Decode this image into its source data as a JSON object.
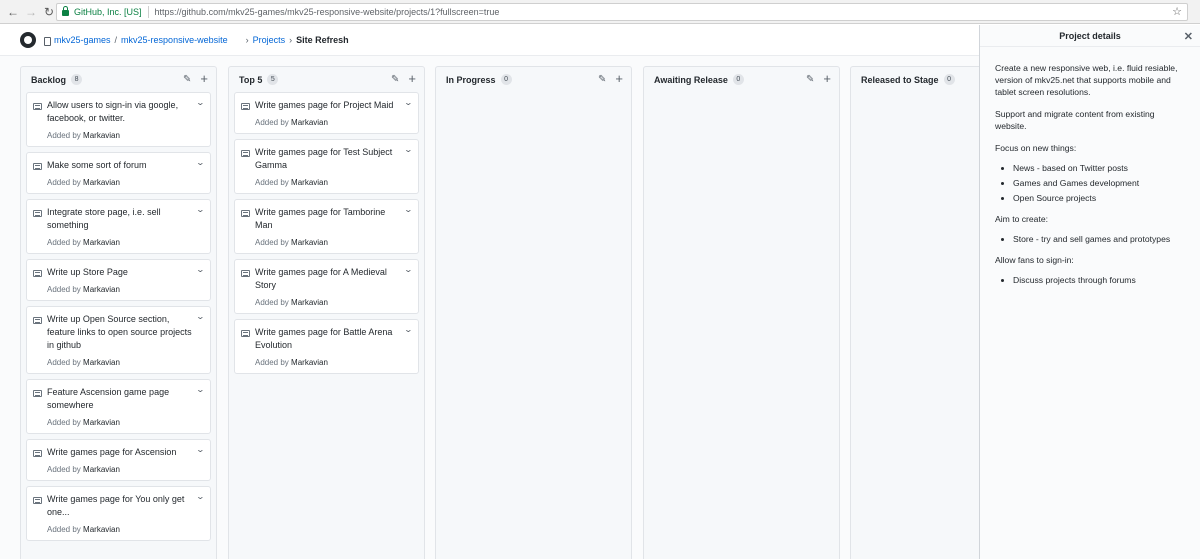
{
  "browser": {
    "secure_label": "GitHub, Inc. [US]",
    "url": "https://github.com/mkv25-games/mkv25-responsive-website/projects/1?fullscreen=true",
    "back_icon": "arrow-left-icon",
    "forward_icon": "arrow-right-icon",
    "reload_icon": "reload-icon",
    "star_icon": "star-icon"
  },
  "header": {
    "owner": "mkv25-games",
    "slash": "/",
    "repo": "mkv25-responsive-website",
    "crumb_sep": "›",
    "projects": "Projects",
    "project_name": "Site Refresh"
  },
  "columns": [
    {
      "name": "Backlog",
      "count": "8",
      "cards": [
        {
          "title": "Allow users to sign-in via google, facebook, or twitter.",
          "added_by": "Added by",
          "author": "Markavian"
        },
        {
          "title": "Make some sort of forum",
          "added_by": "Added by",
          "author": "Markavian"
        },
        {
          "title": "Integrate store page, i.e. sell something",
          "added_by": "Added by",
          "author": "Markavian"
        },
        {
          "title": "Write up Store Page",
          "added_by": "Added by",
          "author": "Markavian"
        },
        {
          "title": "Write up Open Source section, feature links to open source projects in github",
          "added_by": "Added by",
          "author": "Markavian"
        },
        {
          "title": "Feature Ascension game page somewhere",
          "added_by": "Added by",
          "author": "Markavian"
        },
        {
          "title": "Write games page for Ascension",
          "added_by": "Added by",
          "author": "Markavian"
        },
        {
          "title": "Write games page for You only get one...",
          "added_by": "Added by",
          "author": "Markavian"
        }
      ]
    },
    {
      "name": "Top 5",
      "count": "5",
      "cards": [
        {
          "title": "Write games page for Project Maid",
          "added_by": "Added by",
          "author": "Markavian"
        },
        {
          "title": "Write games page for Test Subject Gamma",
          "added_by": "Added by",
          "author": "Markavian"
        },
        {
          "title": "Write games page for Tamborine Man",
          "added_by": "Added by",
          "author": "Markavian"
        },
        {
          "title": "Write games page for A Medieval Story",
          "added_by": "Added by",
          "author": "Markavian"
        },
        {
          "title": "Write games page for Battle Arena Evolution",
          "added_by": "Added by",
          "author": "Markavian"
        }
      ]
    },
    {
      "name": "In Progress",
      "count": "0",
      "cards": []
    },
    {
      "name": "Awaiting Release",
      "count": "0",
      "cards": []
    },
    {
      "name": "Released to Stage",
      "count": "0",
      "cards": []
    }
  ],
  "details": {
    "title": "Project details",
    "close_icon": "close-icon",
    "p1": "Create a new responsive web, i.e. fluid resiable, version of mkv25.net that supports mobile and tablet screen resolutions.",
    "p2": "Support and migrate content from existing website.",
    "p3": "Focus on new things:",
    "list1": [
      "News - based on Twitter posts",
      "Games and Games development",
      "Open Source projects"
    ],
    "p4": "Aim to create:",
    "list2": [
      "Store - try and sell games and prototypes"
    ],
    "p5": "Allow fans to sign-in:",
    "list3": [
      "Discuss projects through forums"
    ]
  }
}
